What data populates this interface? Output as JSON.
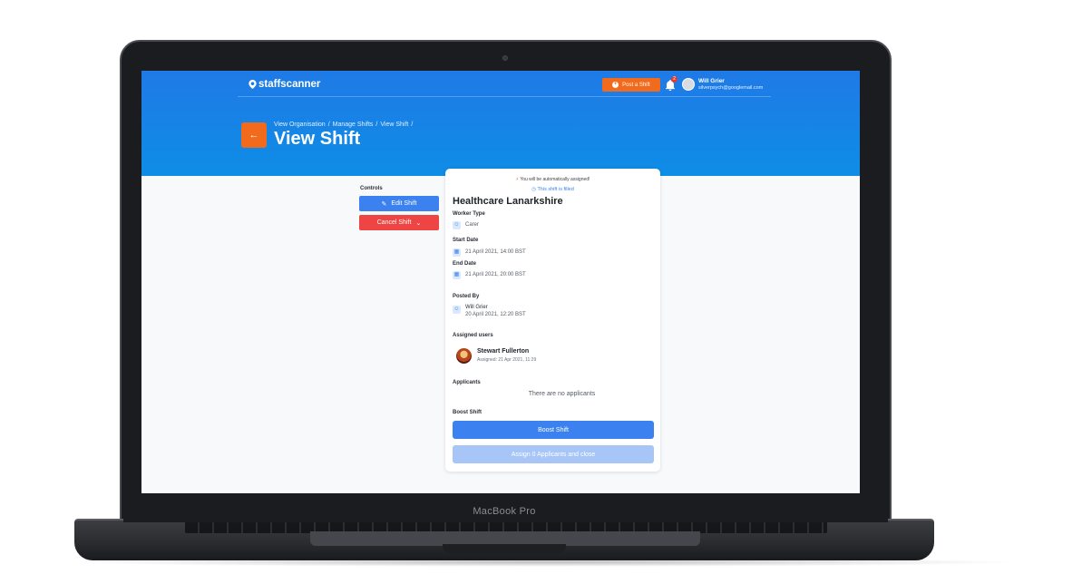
{
  "device": {
    "brand": "MacBook Pro"
  },
  "header": {
    "logo": "staffscanner",
    "post_shift_label": "Post a Shift",
    "notification_count": "2",
    "user": {
      "name": "Will Grier",
      "email": "silverpsych@googlemail.com"
    }
  },
  "breadcrumbs": [
    "View Organisation",
    "/",
    "Manage Shifts",
    "/",
    "View Shift",
    "/"
  ],
  "page_title": "View Shift",
  "controls": {
    "label": "Controls",
    "edit_label": "Edit Shift",
    "cancel_label": "Cancel Shift"
  },
  "shift": {
    "auto_assign_note": "You will be automatically assigned!",
    "status_note": "This shift is filled",
    "organisation": "Healthcare Lanarkshire",
    "worker_type_label": "Worker Type",
    "worker_type": "Carer",
    "start_label": "Start Date",
    "start_value": "21 April 2021, 14:00 BST",
    "end_label": "End Date",
    "end_value": "21 April 2021, 20:00 BST",
    "posted_by_label": "Posted By",
    "posted_by_name": "Will Grier",
    "posted_by_date": "20 April 2021, 12:20 BST",
    "assigned_label": "Assigned users",
    "assignee_name": "Stewart Fullerton",
    "assignee_date": "Assigned: 21 Apr 2021, 11:29",
    "applicants_label": "Applicants",
    "applicants_empty": "There are no applicants",
    "boost_label": "Boost Shift",
    "boost_button": "Boost Shift",
    "assign_button": "Assign 0 Applicants and close"
  },
  "colors": {
    "primary": "#3b82f0",
    "accent": "#f26a1b",
    "danger": "#ef4444",
    "header": "#1f7ae6"
  }
}
